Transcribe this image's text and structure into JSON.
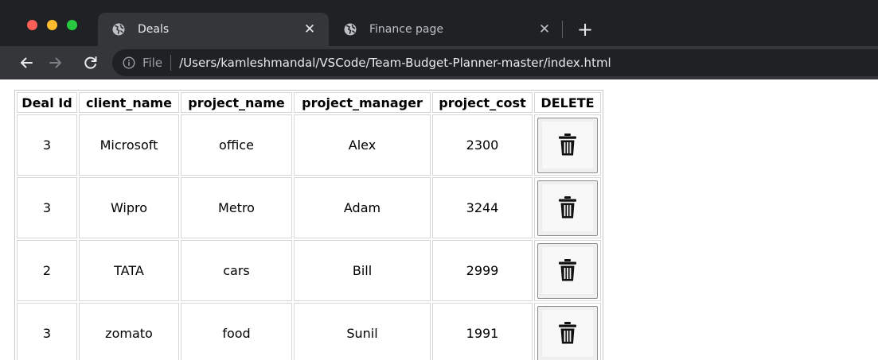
{
  "browser": {
    "tabs": [
      {
        "title": "Deals",
        "active": true
      },
      {
        "title": "Finance page",
        "active": false
      }
    ],
    "address": {
      "scheme_label": "File",
      "url": "/Users/kamleshmandal/VSCode/Team-Budget-Planner-master/index.html"
    },
    "icons": {
      "tab_icon": "globe-icon",
      "info": "info-icon",
      "back": "arrow-left-icon",
      "forward": "arrow-right-icon",
      "reload": "reload-icon",
      "new_tab": "plus-icon",
      "close_tab": "close-icon"
    },
    "close_glyph": "✕",
    "new_tab_glyph": "+"
  },
  "table": {
    "headers": [
      "Deal Id",
      "client_name",
      "project_name",
      "project_manager",
      "project_cost",
      "DELETE"
    ],
    "rows": [
      {
        "deal_id": "3",
        "client_name": "Microsoft",
        "project_name": "office",
        "project_manager": "Alex",
        "project_cost": "2300"
      },
      {
        "deal_id": "3",
        "client_name": "Wipro",
        "project_name": "Metro",
        "project_manager": "Adam",
        "project_cost": "3244"
      },
      {
        "deal_id": "2",
        "client_name": "TATA",
        "project_name": "cars",
        "project_manager": "Bill",
        "project_cost": "2999"
      },
      {
        "deal_id": "3",
        "client_name": "zomato",
        "project_name": "food",
        "project_manager": "Sunil",
        "project_cost": "1991"
      }
    ],
    "delete_icon": "trash-icon"
  },
  "colors": {
    "titlebar": "#202124",
    "toolbar": "#35363a",
    "close": "#ff5f57",
    "minimize": "#febc2e",
    "maximize": "#28c840"
  }
}
